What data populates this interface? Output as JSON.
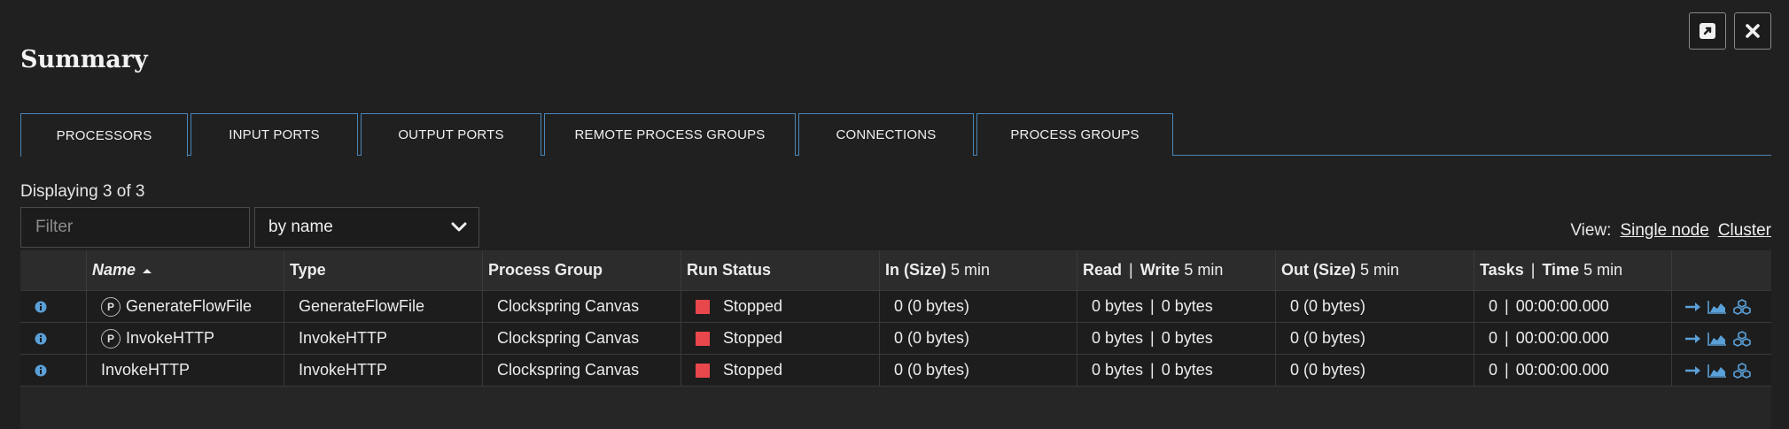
{
  "dialog": {
    "title": "Summary",
    "popout_icon": "popout-icon",
    "close_icon": "close-icon"
  },
  "tabs": [
    {
      "label": "PROCESSORS",
      "active": true
    },
    {
      "label": "INPUT PORTS"
    },
    {
      "label": "OUTPUT PORTS"
    },
    {
      "label": "REMOTE PROCESS GROUPS"
    },
    {
      "label": "CONNECTIONS"
    },
    {
      "label": "PROCESS GROUPS"
    }
  ],
  "displaying": "Displaying 3 of 3",
  "filter": {
    "placeholder": "Filter",
    "value": ""
  },
  "filter_by": {
    "selected": "by name"
  },
  "view": {
    "label": "View:",
    "single_node": "Single node",
    "cluster": "Cluster"
  },
  "columns": {
    "name": "Name",
    "type": "Type",
    "process_group": "Process Group",
    "run_status": "Run Status",
    "in": "In (Size)",
    "read": "Read",
    "write": "Write",
    "out": "Out (Size)",
    "tasks": "Tasks",
    "time": "Time",
    "window": "5 min",
    "separator": "|"
  },
  "rows": [
    {
      "badge": "P",
      "name": "GenerateFlowFile",
      "type": "GenerateFlowFile",
      "group": "Clockspring Canvas",
      "status": "Stopped",
      "in": "0 (0 bytes)",
      "read": "0 bytes",
      "write": "0 bytes",
      "out": "0 (0 bytes)",
      "tasks": "0",
      "time": "00:00:00.000"
    },
    {
      "badge": "P",
      "name": "InvokeHTTP",
      "type": "InvokeHTTP",
      "group": "Clockspring Canvas",
      "status": "Stopped",
      "in": "0 (0 bytes)",
      "read": "0 bytes",
      "write": "0 bytes",
      "out": "0 (0 bytes)",
      "tasks": "0",
      "time": "00:00:00.000"
    },
    {
      "badge": "",
      "name": "InvokeHTTP",
      "type": "InvokeHTTP",
      "group": "Clockspring Canvas",
      "status": "Stopped",
      "in": "0 (0 bytes)",
      "read": "0 bytes",
      "write": "0 bytes",
      "out": "0 (0 bytes)",
      "tasks": "0",
      "time": "00:00:00.000"
    }
  ],
  "colors": {
    "accent": "#4a86b8",
    "stopped": "#e8474c",
    "icon_blue": "#5aa0d8"
  }
}
